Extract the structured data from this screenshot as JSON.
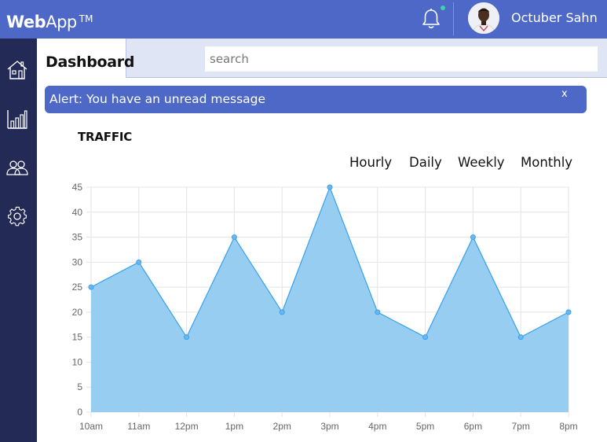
{
  "header": {
    "brand_bold": "Web",
    "brand_rest": "App",
    "brand_tm": "TM",
    "user_name": "Octuber Sahn",
    "has_notification": true,
    "accent": "#4d68c6",
    "notification_dot_color": "#3cd3a5"
  },
  "sidebar": {
    "items": [
      {
        "icon": "home-icon"
      },
      {
        "icon": "bar-chart-icon"
      },
      {
        "icon": "users-icon"
      },
      {
        "icon": "gear-icon"
      }
    ],
    "color": "#232a56"
  },
  "tabs": {
    "active_label": "Dashboard"
  },
  "search": {
    "placeholder": "search",
    "value": ""
  },
  "alert": {
    "text": "Alert: You have an unread message",
    "close_label": "x"
  },
  "traffic": {
    "title": "TRAFFIC",
    "ranges": [
      "Hourly",
      "Daily",
      "Weekly",
      "Monthly"
    ]
  },
  "chart_data": {
    "type": "area",
    "x": [
      "10am",
      "11am",
      "12pm",
      "1pm",
      "2pm",
      "3pm",
      "4pm",
      "5pm",
      "6pm",
      "7pm",
      "8pm"
    ],
    "series": [
      {
        "values": [
          25,
          30,
          15,
          35,
          20,
          45,
          20,
          15,
          35,
          15,
          20
        ]
      }
    ],
    "ylim": [
      0,
      45
    ],
    "yticks": [
      0,
      5,
      10,
      15,
      20,
      25,
      30,
      35,
      40,
      45
    ],
    "grid": true,
    "fill_color": "#98cdf2",
    "line_color": "#36a2eb"
  }
}
